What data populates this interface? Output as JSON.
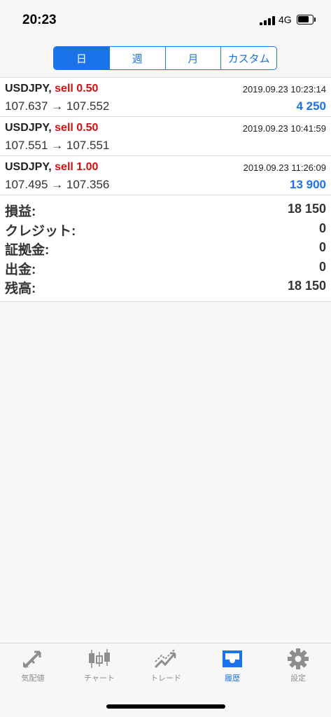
{
  "status_bar": {
    "time": "20:23",
    "network": "4G"
  },
  "segments": [
    {
      "label": "日",
      "active": true
    },
    {
      "label": "週",
      "active": false
    },
    {
      "label": "月",
      "active": false
    },
    {
      "label": "カスタム",
      "active": false
    }
  ],
  "deals": [
    {
      "symbol": "USDJPY,",
      "side": "sell 0.50",
      "time": "2019.09.23 10:23:14",
      "prices": "107.637 → 107.552",
      "profit": "4 250"
    },
    {
      "symbol": "USDJPY,",
      "side": "sell 0.50",
      "time": "2019.09.23 10:41:59",
      "prices": "107.551 → 107.551",
      "profit": ""
    },
    {
      "symbol": "USDJPY,",
      "side": "sell 1.00",
      "time": "2019.09.23 11:26:09",
      "prices": "107.495 → 107.356",
      "profit": "13 900"
    }
  ],
  "summary": [
    {
      "label": "損益:",
      "value": "18 150"
    },
    {
      "label": "クレジット:",
      "value": "0"
    },
    {
      "label": "証拠金:",
      "value": "0"
    },
    {
      "label": "出金:",
      "value": "0"
    },
    {
      "label": "残高:",
      "value": "18 150"
    }
  ],
  "tabs": [
    {
      "label": "気配値",
      "icon": "quotes-icon",
      "active": false
    },
    {
      "label": "チャート",
      "icon": "chart-icon",
      "active": false
    },
    {
      "label": "トレード",
      "icon": "trade-icon",
      "active": false
    },
    {
      "label": "履歴",
      "icon": "history-icon",
      "active": true
    },
    {
      "label": "設定",
      "icon": "settings-icon",
      "active": false
    }
  ],
  "colors": {
    "accent": "#1a73e8",
    "sell": "#d01010",
    "inactive_tab": "#8e8e8e"
  }
}
